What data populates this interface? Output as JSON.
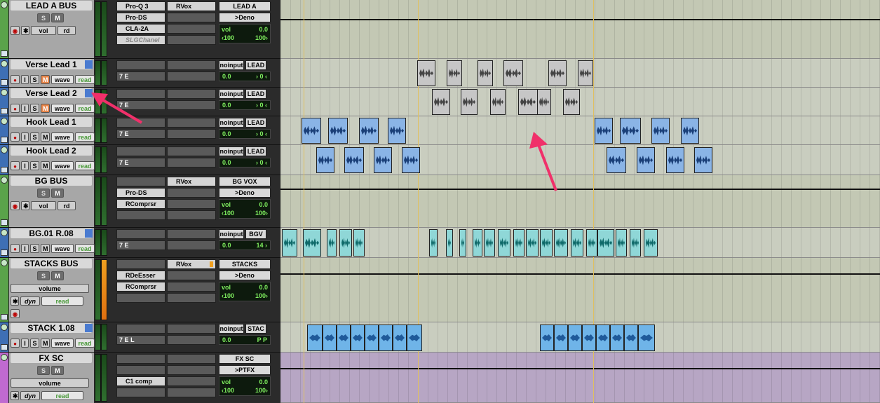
{
  "colors": {
    "lead_bus": "#59a34a",
    "audio_blue": "#3e6fb5",
    "bg_bus": "#59a34a",
    "stacks_bus": "#59a34a",
    "fx_sc": "#c06ad0",
    "arrow": "#f0306a"
  },
  "tracks": [
    {
      "name": "LEAD A BUS",
      "type": "aux",
      "color": "#5aa34a",
      "mute": "M",
      "solo": "S",
      "auto_view": "vol",
      "auto_mode": "rd",
      "inserts": [
        "Pro-Q 3",
        "Pro-DS",
        "CLA-2A",
        "SLGChanel"
      ],
      "sends": [
        "RVox"
      ],
      "io": {
        "input": "LEAD A",
        "output": ">Deno",
        "vol_label": "vol",
        "vol_value": "0.0",
        "pan_left": "‹100",
        "pan_right": "100›"
      }
    },
    {
      "name": "Verse Lead 1",
      "type": "audio",
      "color": "#3e6fb5",
      "rec": "●",
      "input": "I",
      "solo": "S",
      "mute": "M",
      "mute_on": true,
      "view": "wave",
      "mode": "read",
      "dsp": "7",
      "elastic": "E",
      "io": {
        "input": "noinput",
        "output": "LEAD",
        "vol": "0.0",
        "pan": "› 0 ‹"
      }
    },
    {
      "name": "Verse Lead 2",
      "type": "audio",
      "color": "#3e6fb5",
      "rec": "●",
      "input": "I",
      "solo": "S",
      "mute": "M",
      "mute_on": true,
      "view": "wave",
      "mode": "read",
      "dsp": "7",
      "elastic": "E",
      "io": {
        "input": "noinput",
        "output": "LEAD",
        "vol": "0.0",
        "pan": "› 0 ‹"
      }
    },
    {
      "name": "Hook Lead 1",
      "type": "audio",
      "color": "#3e6fb5",
      "rec": "●",
      "input": "I",
      "solo": "S",
      "mute": "M",
      "mute_on": false,
      "view": "wave",
      "mode": "read",
      "dsp": "7",
      "elastic": "E",
      "io": {
        "input": "noinput",
        "output": "LEAD",
        "vol": "0.0",
        "pan": "› 0 ‹"
      }
    },
    {
      "name": "Hook Lead 2",
      "type": "audio",
      "color": "#3e6fb5",
      "rec": "●",
      "input": "I",
      "solo": "S",
      "mute": "M",
      "mute_on": false,
      "view": "wave",
      "mode": "read",
      "dsp": "7",
      "elastic": "E",
      "io": {
        "input": "noinput",
        "output": "LEAD",
        "vol": "0.0",
        "pan": "› 0 ‹"
      }
    },
    {
      "name": "BG BUS",
      "type": "aux",
      "color": "#5aa34a",
      "mute": "M",
      "solo": "S",
      "auto_view": "vol",
      "auto_mode": "rd",
      "inserts": [
        "",
        "Pro-DS",
        "RComprsr",
        ""
      ],
      "sends": [
        "RVox"
      ],
      "io": {
        "input": "BG VOX",
        "output": ">Deno",
        "vol_label": "vol",
        "vol_value": "0.0",
        "pan_left": "‹100",
        "pan_right": "100›"
      }
    },
    {
      "name": "BG.01 R.08",
      "type": "audio",
      "color": "#3e6fb5",
      "rec": "●",
      "input": "I",
      "solo": "S",
      "mute": "M",
      "mute_on": false,
      "view": "wave",
      "mode": "read",
      "dsp": "7",
      "elastic": "E",
      "io": {
        "input": "noinput",
        "output": "BGV",
        "vol": "0.0",
        "pan": "14 ›"
      }
    },
    {
      "name": "STACKS BUS",
      "type": "aux",
      "color": "#5aa34a",
      "mute": "M",
      "solo": "S",
      "auto_view": "volume",
      "dyn": "dyn",
      "auto_mode": "read",
      "inserts": [
        "",
        "RDeEsser",
        "RComprsr",
        ""
      ],
      "sends": [
        "RVox"
      ],
      "io": {
        "input": "STACKS",
        "output": ">Deno",
        "vol_label": "vol",
        "vol_value": "0.0",
        "pan_left": "‹100",
        "pan_right": "100›"
      }
    },
    {
      "name": "STACK 1.08",
      "type": "audio",
      "color": "#3e6fb5",
      "rec": "●",
      "input": "I",
      "solo": "S",
      "mute": "M",
      "mute_on": false,
      "view": "wave",
      "mode": "read",
      "dsp": "7",
      "elastic": "E",
      "extra": "L",
      "io": {
        "input": "noinput",
        "output": "STAC",
        "vol": "0.0",
        "pan_l": "P",
        "pan_r": "P"
      }
    },
    {
      "name": "FX SC",
      "type": "aux",
      "color": "#c06ad0",
      "mute": "M",
      "solo": "S",
      "auto_view": "volume",
      "dyn": "dyn",
      "auto_mode": "read",
      "inserts": [
        "",
        "",
        "C1 comp",
        ""
      ],
      "sends": [],
      "io": {
        "input": "FX SC",
        "output": ">PTFX",
        "vol_label": "vol",
        "vol_value": "0.0",
        "pan_left": "‹100",
        "pan_right": "100›"
      }
    }
  ]
}
